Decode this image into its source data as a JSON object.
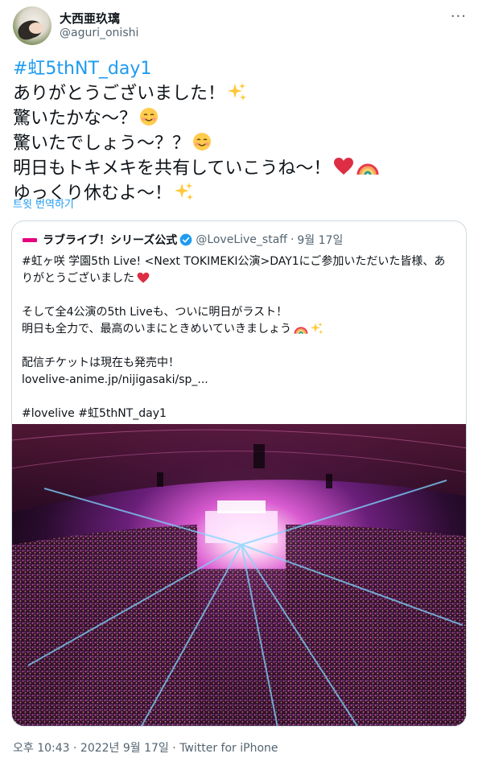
{
  "author": {
    "display_name": "大西亜玖璃",
    "handle": "@aguri_onishi"
  },
  "more_icon": "more-horizontal-icon",
  "tweet": {
    "hashtag": "#虹5thNT_day1",
    "lines": [
      "ありがとうございました！",
      "驚いたかな～？",
      "驚いたでしょう～？？",
      "明日もトキメキを共有していこうね～！",
      "ゆっくり休むよ～！"
    ],
    "emojis": [
      "sparkles-icon",
      "smiling-face-icon",
      "smiling-face-icon",
      "red-heart-icon rainbow-icon",
      "sparkles-icon"
    ]
  },
  "translate_label": "트윗 번역하기",
  "quoted": {
    "name": "ラブライブ！シリーズ公式",
    "handle": "@LoveLive_staff",
    "separator": "·",
    "date": "9월 17일",
    "lines": [
      "#虹ヶ咲 学園5th Live! <Next TOKIMEKI公演>DAY1にご参加いただいた皆様、あ",
      "りがとうございました",
      "",
      "そして全4公演の5th Liveも、ついに明日がラスト！",
      "明日も全力で、最高のいまにときめいていきましょう",
      "",
      "配信チケットは現在も発売中！",
      "lovelive-anime.jp/nijigasaki/sp_...",
      "",
      "#lovelive  #虹5thNT_day1"
    ],
    "media_alt": "concert-arena-photo"
  },
  "footer": {
    "time": "오후 10:43",
    "sep1": " · ",
    "date": "2022년 9월 17일",
    "sep2": " · ",
    "source": "Twitter for iPhone"
  },
  "colors": {
    "link": "#1d9bf0",
    "secondary": "#536471",
    "border": "#cfd9de",
    "brand_pink": "#e4007f"
  }
}
